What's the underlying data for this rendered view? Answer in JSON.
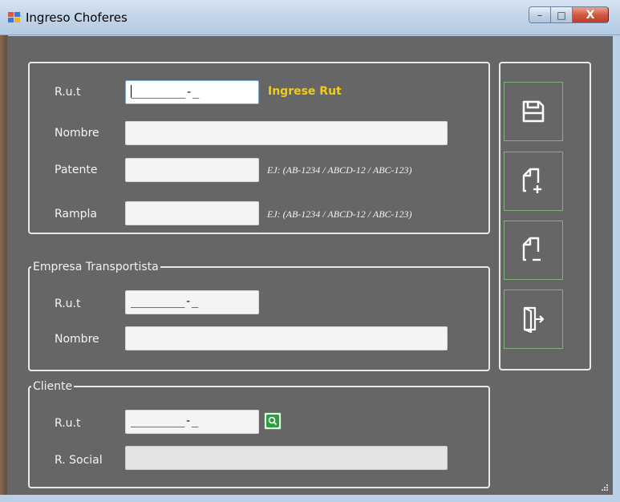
{
  "window": {
    "title": "Ingreso Choferes",
    "controls": {
      "minimize": "–",
      "maximize": "□",
      "close": "X"
    }
  },
  "chofer": {
    "rut_label": "R.u.t",
    "rut_value": "________-_",
    "rut_hint": "Ingrese Rut",
    "nombre_label": "Nombre",
    "nombre_value": "",
    "patente_label": "Patente",
    "patente_value": "",
    "patente_hint": "EJ: (AB-1234 / ABCD-12 / ABC-123)",
    "rampla_label": "Rampla",
    "rampla_value": "",
    "rampla_hint": "EJ: (AB-1234 / ABCD-12 / ABC-123)"
  },
  "empresa": {
    "legend": "Empresa Transportista",
    "rut_label": "R.u.t",
    "rut_value": "________-_",
    "nombre_label": "Nombre",
    "nombre_value": ""
  },
  "cliente": {
    "legend": "Cliente",
    "rut_label": "R.u.t",
    "rut_value": "________-_",
    "razon_label": "R. Social",
    "razon_value": ""
  },
  "toolbar": {
    "icons": [
      "save-icon",
      "add-document-icon",
      "remove-document-icon",
      "exit-icon"
    ]
  },
  "colors": {
    "background": "#666666",
    "hint_yellow": "#f2cc1a",
    "tool_border": "#7fb27f",
    "search_green": "#2e9e3e"
  }
}
